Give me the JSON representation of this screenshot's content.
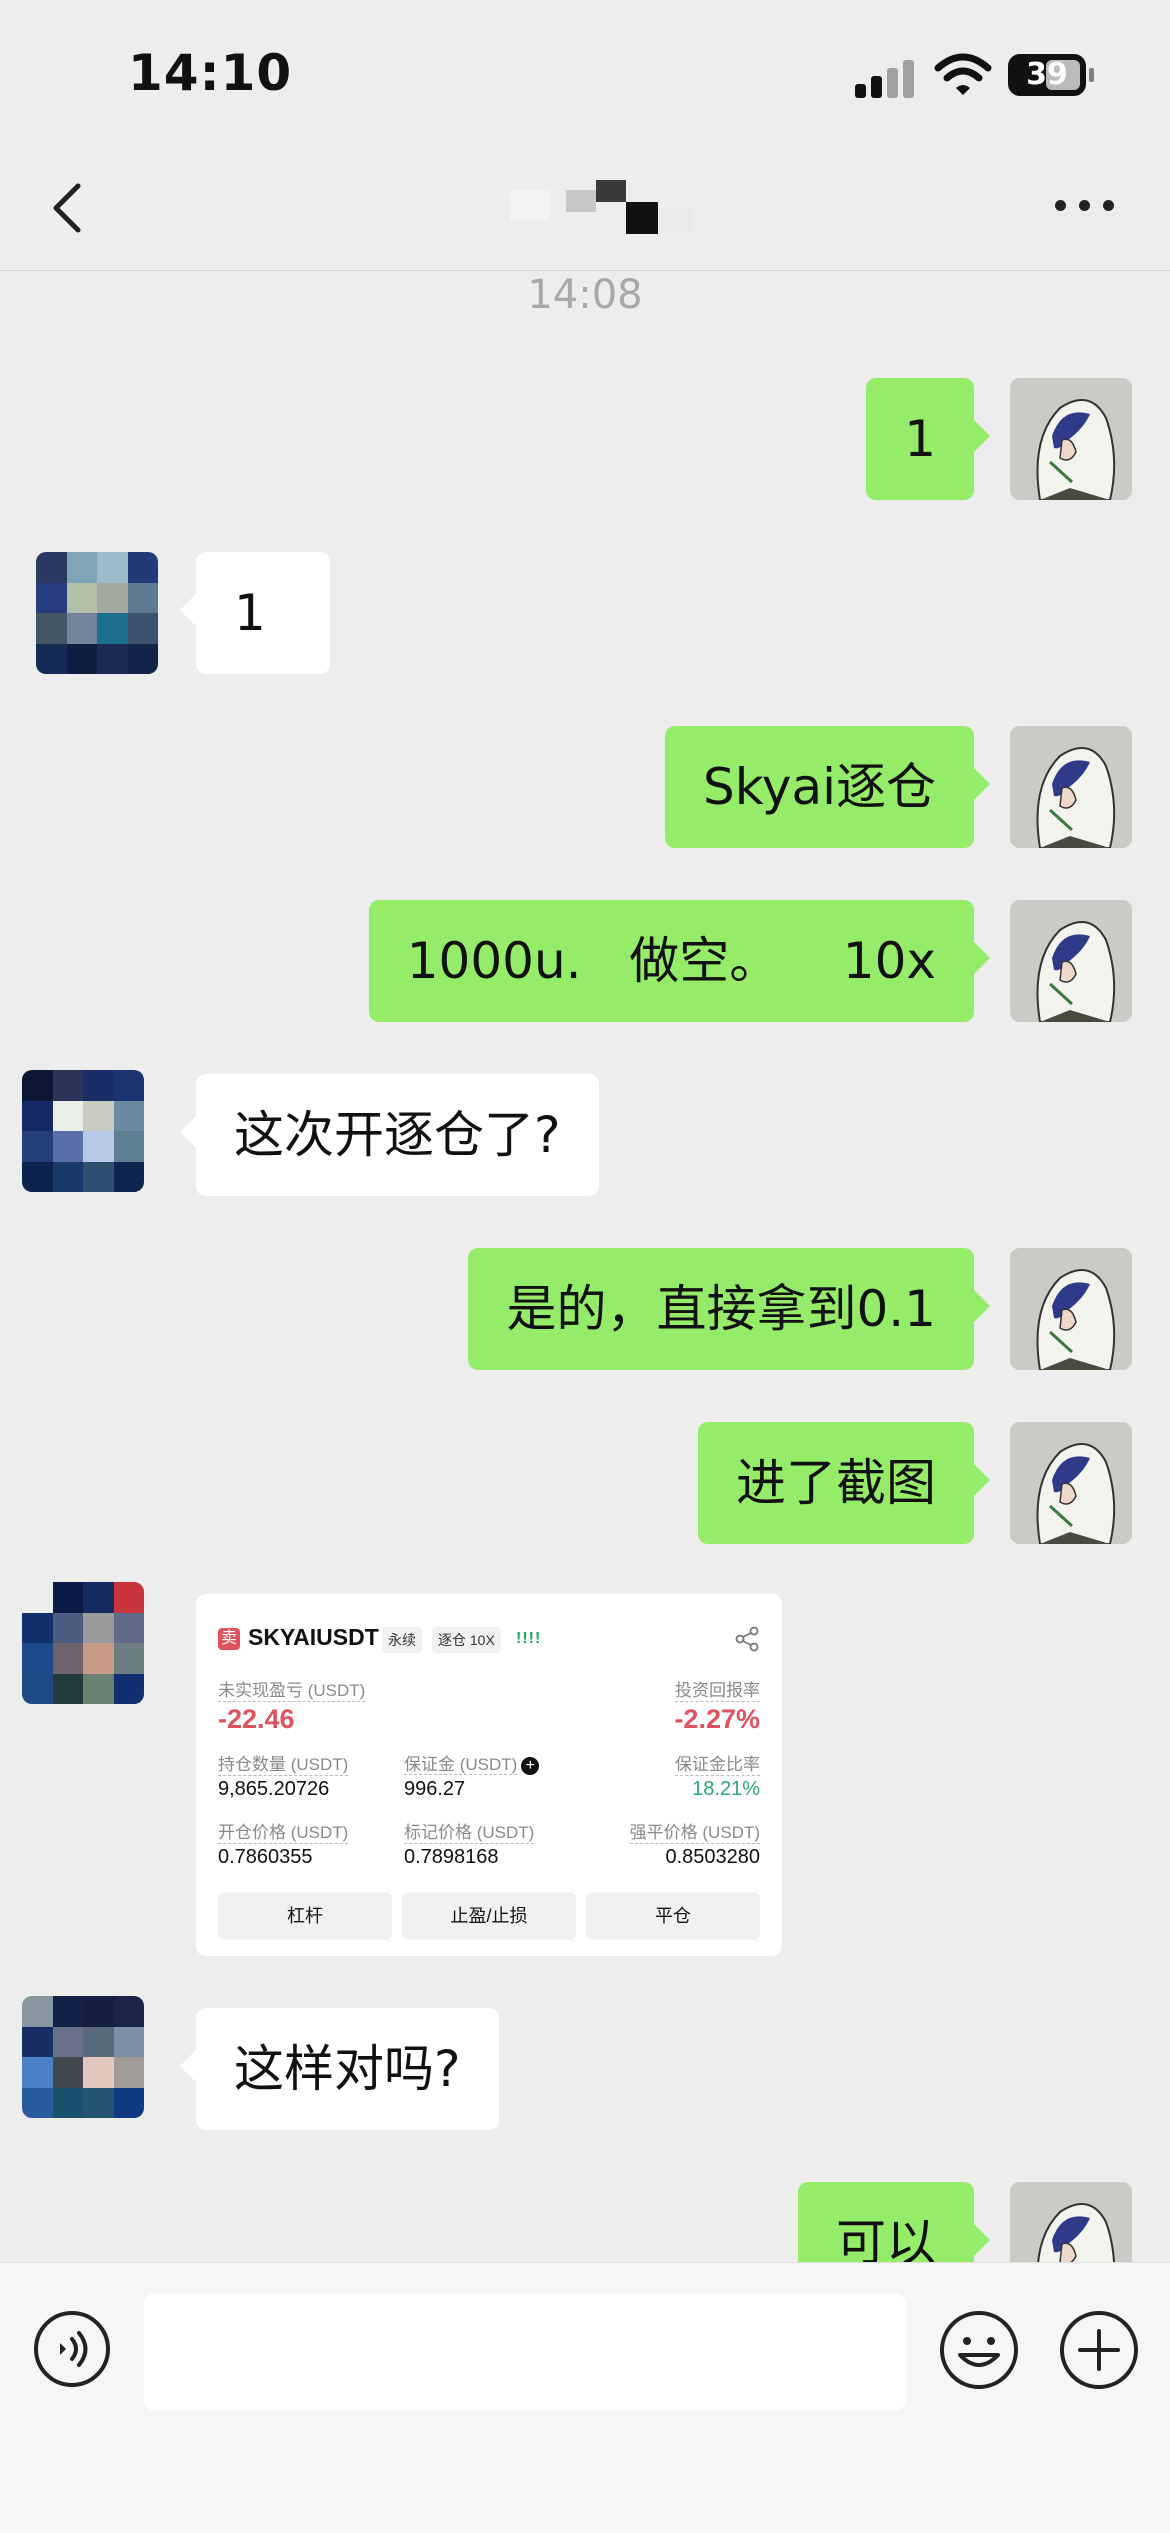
{
  "status_bar": {
    "time": "14:10",
    "battery": "39"
  },
  "timestamp": "14:08",
  "messages": [
    {
      "text": "1"
    },
    {
      "text": "1"
    },
    {
      "text": "Skyai逐仓"
    },
    {
      "text": "1000u.   做空。    10x"
    },
    {
      "text": "这次开逐仓了?"
    },
    {
      "text": "是的，直接拿到0.1"
    },
    {
      "text": "进了截图"
    },
    {
      "text": "这样对吗?"
    },
    {
      "text": "可以"
    }
  ],
  "trade_card": {
    "side_tag": "卖",
    "symbol": "SKYAIUSDT",
    "contract": "永续",
    "margin_mode": "逐仓 10X",
    "signal": "!!!!",
    "unrealized_pnl_label": "未实现盈亏 (USDT)",
    "unrealized_pnl": "-22.46",
    "roi_label": "投资回报率",
    "roi": "-2.27%",
    "position_size_label": "持仓数量 (USDT)",
    "position_size": "9,865.20726",
    "margin_label": "保证金 (USDT)",
    "margin": "996.27",
    "margin_ratio_label": "保证金比率",
    "margin_ratio": "18.21%",
    "entry_price_label": "开仓价格 (USDT)",
    "entry_price": "0.7860355",
    "mark_price_label": "标记价格 (USDT)",
    "mark_price": "0.7898168",
    "liq_price_label": "强平价格 (USDT)",
    "liq_price": "0.8503280",
    "btn_leverage": "杠杆",
    "btn_tpsl": "止盈/止损",
    "btn_close": "平仓"
  },
  "icons": [
    "back-icon",
    "more-icon",
    "voice-icon",
    "emoji-icon",
    "plus-icon",
    "share-icon"
  ],
  "colors": {
    "my_bubble": "#95ec69",
    "their_bubble": "#ffffff",
    "background": "#ededed",
    "loss_red": "#e0525e",
    "gain_green": "#2ea872"
  }
}
